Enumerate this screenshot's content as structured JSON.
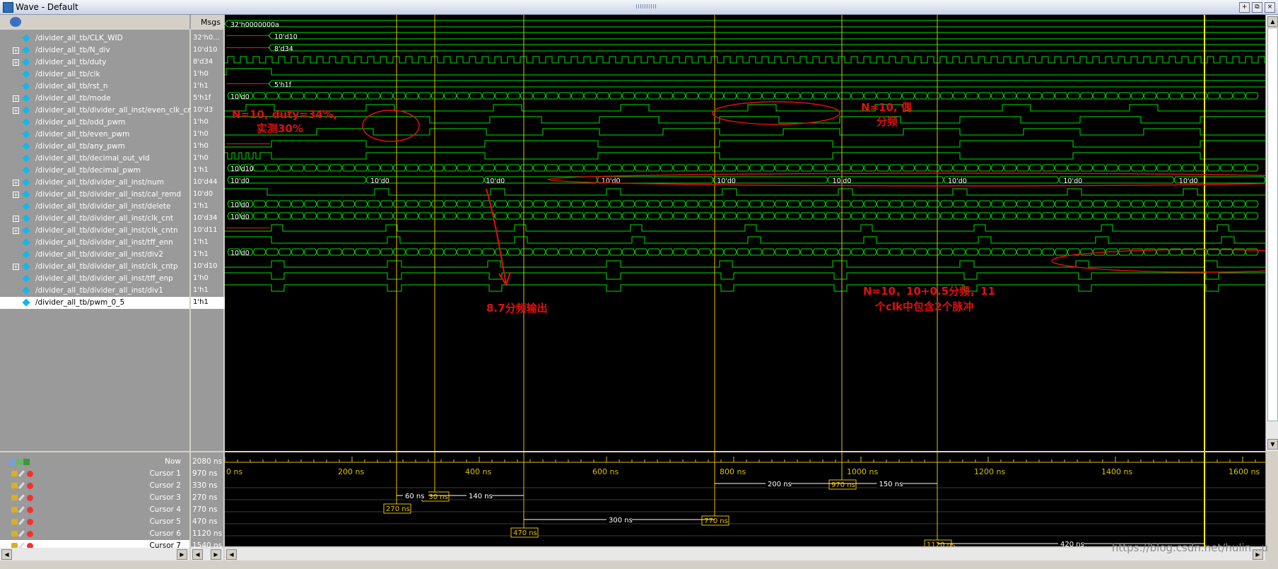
{
  "window": {
    "title": "Wave - Default"
  },
  "header": {
    "msgs_label": "Msgs"
  },
  "signals": [
    {
      "name": "/divider_all_tb/CLK_WID",
      "value": "32'h0...",
      "expand": false
    },
    {
      "name": "/divider_all_tb/N_div",
      "value": "10'd10",
      "expand": true
    },
    {
      "name": "/divider_all_tb/duty",
      "value": "8'd34",
      "expand": true
    },
    {
      "name": "/divider_all_tb/clk",
      "value": "1'h0",
      "expand": false
    },
    {
      "name": "/divider_all_tb/rst_n",
      "value": "1'h1",
      "expand": false
    },
    {
      "name": "/divider_all_tb/mode",
      "value": "5'h1f",
      "expand": true
    },
    {
      "name": "/divider_all_tb/divider_all_inst/even_clk_cnt",
      "value": "10'd3",
      "expand": true
    },
    {
      "name": "/divider_all_tb/odd_pwm",
      "value": "1'h0",
      "expand": false
    },
    {
      "name": "/divider_all_tb/even_pwm",
      "value": "1'h0",
      "expand": false
    },
    {
      "name": "/divider_all_tb/any_pwm",
      "value": "1'h0",
      "expand": false
    },
    {
      "name": "/divider_all_tb/decimal_out_vld",
      "value": "1'h0",
      "expand": false
    },
    {
      "name": "/divider_all_tb/decimal_pwm",
      "value": "1'h1",
      "expand": false
    },
    {
      "name": "/divider_all_tb/divider_all_inst/num",
      "value": "10'd44",
      "expand": true
    },
    {
      "name": "/divider_all_tb/divider_all_inst/cal_remd",
      "value": "10'd0",
      "expand": true
    },
    {
      "name": "/divider_all_tb/divider_all_inst/delete",
      "value": "1'h1",
      "expand": false
    },
    {
      "name": "/divider_all_tb/divider_all_inst/clk_cnt",
      "value": "10'd34",
      "expand": true
    },
    {
      "name": "/divider_all_tb/divider_all_inst/clk_cntn",
      "value": "10'd11",
      "expand": true
    },
    {
      "name": "/divider_all_tb/divider_all_inst/tff_enn",
      "value": "1'h1",
      "expand": false
    },
    {
      "name": "/divider_all_tb/divider_all_inst/div2",
      "value": "1'h1",
      "expand": false
    },
    {
      "name": "/divider_all_tb/divider_all_inst/clk_cntp",
      "value": "10'd10",
      "expand": true
    },
    {
      "name": "/divider_all_tb/divider_all_inst/tff_enp",
      "value": "1'h0",
      "expand": false
    },
    {
      "name": "/divider_all_tb/divider_all_inst/div1",
      "value": "1'h1",
      "expand": false
    },
    {
      "name": "/divider_all_tb/pwm_0_5",
      "value": "1'h1",
      "expand": false,
      "selected": true
    }
  ],
  "bus_labels": {
    "clk_wid": "32'h0000000a",
    "n_div": "10'd10",
    "duty": "8'd34",
    "mode": "5'h1f",
    "even_clk_cnt": "10'd0",
    "num": "10'd10",
    "cal_remd_start": "10'd0",
    "cal_remd_repeat": [
      "10'd0",
      "10'd0",
      "10'd0",
      "10'd0",
      "10'd0",
      "10'd0",
      "10'd0",
      "10'd0"
    ],
    "clk_cnt": "10'd0",
    "clk_cntn": "10'd0",
    "clk_cntp": "10'd0"
  },
  "timeline": {
    "now_label": "Now",
    "now_value": "2080 ns",
    "ticks": [
      "0 ns",
      "200 ns",
      "400 ns",
      "600 ns",
      "800 ns",
      "1000 ns",
      "1200 ns",
      "1400 ns",
      "1600 ns"
    ],
    "tick_values": [
      0,
      200,
      400,
      600,
      800,
      1000,
      1200,
      1400,
      1600
    ]
  },
  "cursors": [
    {
      "name": "Cursor 1",
      "value": "970 ns",
      "time": 970,
      "tag": "970 ns"
    },
    {
      "name": "Cursor 2",
      "value": "330 ns",
      "time": 330,
      "tag": "330 ns"
    },
    {
      "name": "Cursor 3",
      "value": "270 ns",
      "time": 270,
      "tag": "270 ns"
    },
    {
      "name": "Cursor 4",
      "value": "770 ns",
      "time": 770,
      "tag": "770 ns"
    },
    {
      "name": "Cursor 5",
      "value": "470 ns",
      "time": 470,
      "tag": "470 ns"
    },
    {
      "name": "Cursor 6",
      "value": "1120 ns",
      "time": 1120,
      "tag": "1120 ns"
    },
    {
      "name": "Cursor 7",
      "value": "1540 ns",
      "time": 1540,
      "tag": "1540 ns",
      "selected": true
    }
  ],
  "deltas": [
    {
      "label": "200 ns",
      "from": 770,
      "to": 970,
      "row": 0
    },
    {
      "label": "150 ns",
      "from": 970,
      "to": 1120,
      "row": 0
    },
    {
      "label": "60 ns",
      "from": 270,
      "to": 330,
      "row": 1
    },
    {
      "label": "140 ns",
      "from": 330,
      "to": 470,
      "row": 1
    },
    {
      "label": "300 ns",
      "from": 470,
      "to": 770,
      "row": 3
    },
    {
      "label": "420 ns",
      "from": 1120,
      "to": 1540,
      "row": 5
    }
  ],
  "annotations": {
    "a1_line1": "N=10, duty=34%,",
    "a1_line2": "实测30%",
    "a2_line1": "N=10, 偶",
    "a2_line2": "分频",
    "a3": "8.7分频输出",
    "a4_line1": "N=10，10+0.5分频，11",
    "a4_line2": "个clk中包含2个脉冲"
  },
  "watermark": "https://blog.csdn.net/hulin...u",
  "colors": {
    "wave": "#00e000",
    "cursor": "#e8c000",
    "annotation": "#e01010",
    "tick": "#d8c000",
    "selected_cursor": "#ffff00"
  }
}
